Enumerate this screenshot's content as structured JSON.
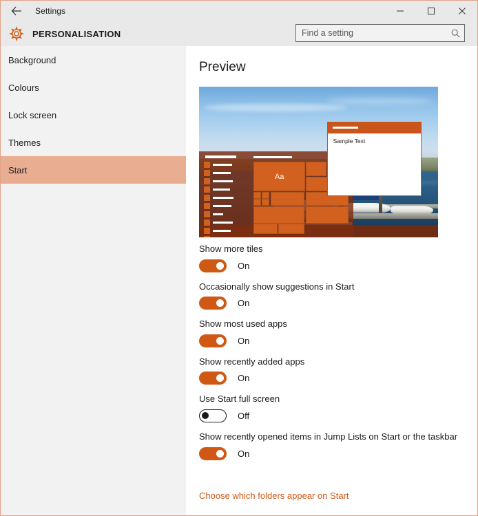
{
  "titlebar": {
    "title": "Settings",
    "back_icon": "back-arrow-icon",
    "minimize_icon": "minimize-icon",
    "maximize_icon": "maximize-icon",
    "close_icon": "close-icon"
  },
  "header": {
    "gear_icon": "gear-icon",
    "title": "PERSONALISATION",
    "search": {
      "placeholder": "Find a setting",
      "value": "",
      "icon": "search-icon"
    }
  },
  "sidebar": {
    "items": [
      {
        "label": "Background",
        "selected": false
      },
      {
        "label": "Colours",
        "selected": false
      },
      {
        "label": "Lock screen",
        "selected": false
      },
      {
        "label": "Themes",
        "selected": false
      },
      {
        "label": "Start",
        "selected": true
      }
    ]
  },
  "main": {
    "heading": "Preview",
    "preview": {
      "window_mock_text": "Sample Text",
      "tile_text": "Aa"
    },
    "settings": [
      {
        "label": "Show more tiles",
        "state": "On",
        "on": true
      },
      {
        "label": "Occasionally show suggestions in Start",
        "state": "On",
        "on": true
      },
      {
        "label": "Show most used apps",
        "state": "On",
        "on": true
      },
      {
        "label": "Show recently added apps",
        "state": "On",
        "on": true
      },
      {
        "label": "Use Start full screen",
        "state": "Off",
        "on": false
      },
      {
        "label": "Show recently opened items in Jump Lists on Start or the taskbar",
        "state": "On",
        "on": true
      }
    ],
    "folders_link": "Choose which folders appear on Start"
  },
  "colors": {
    "accent": "#cf5814",
    "selected_nav": "#e9ae92",
    "window_border": "#e0a289",
    "chrome": "#e9e9e9",
    "sidebar": "#f2f2f2"
  }
}
